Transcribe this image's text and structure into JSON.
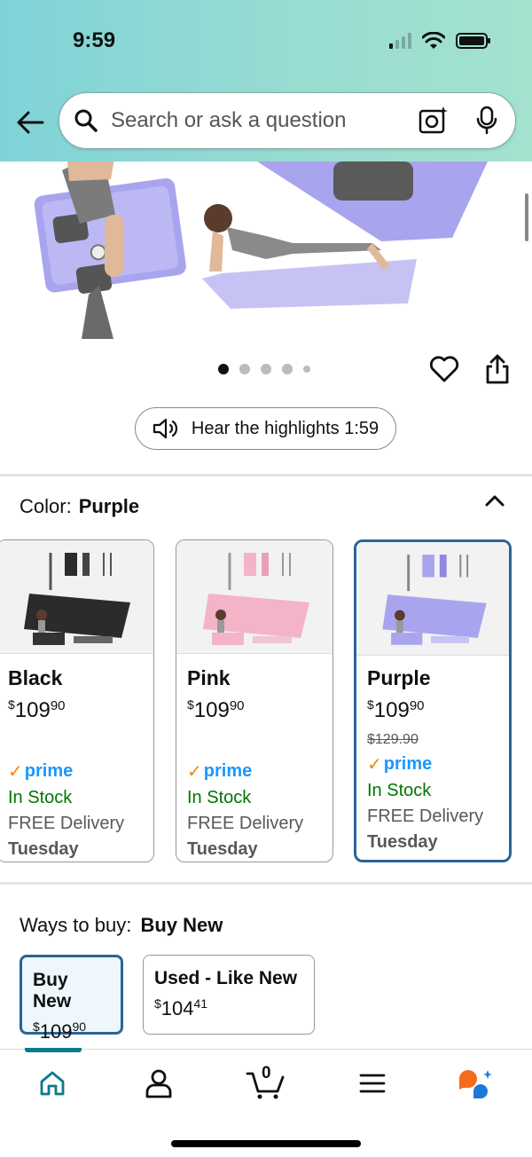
{
  "status_bar": {
    "time": "9:59"
  },
  "search": {
    "placeholder": "Search or ask a question"
  },
  "carousel": {
    "total_dots": 5,
    "active_index": 0
  },
  "audio": {
    "label": "Hear the highlights 1:59"
  },
  "color_section": {
    "label": "Color:",
    "selected": "Purple"
  },
  "variants": [
    {
      "name": "Black",
      "price_symbol": "$",
      "price_whole": "109",
      "price_cents": "90",
      "list_price": "",
      "prime": "prime",
      "stock": "In Stock",
      "delivery": "FREE Delivery",
      "day": "Tuesday",
      "selected": false,
      "accent": "#2b2b2b"
    },
    {
      "name": "Pink",
      "price_symbol": "$",
      "price_whole": "109",
      "price_cents": "90",
      "list_price": "",
      "prime": "prime",
      "stock": "In Stock",
      "delivery": "FREE Delivery",
      "day": "Tuesday",
      "selected": false,
      "accent": "#f3b4c8"
    },
    {
      "name": "Purple",
      "price_symbol": "$",
      "price_whole": "109",
      "price_cents": "90",
      "list_price": "$129.90",
      "prime": "prime",
      "stock": "In Stock",
      "delivery": "FREE Delivery",
      "day": "Tuesday",
      "selected": true,
      "accent": "#a9a4ee"
    }
  ],
  "ways_to_buy": {
    "label": "Ways to buy:",
    "selected": "Buy New",
    "options": [
      {
        "title": "Buy New",
        "price_symbol": "$",
        "price_whole": "109",
        "price_cents": "90"
      },
      {
        "title": "Used - Like New",
        "price_symbol": "$",
        "price_whole": "104",
        "price_cents": "41"
      }
    ]
  },
  "nav": {
    "cart_count": "0",
    "active": "home"
  },
  "colors": {
    "prime_blue": "#1a98ff",
    "in_stock_green": "#007600",
    "selection_blue": "#2a6496",
    "nav_teal": "#0a7a8c",
    "accent_orange": "#f08804"
  }
}
